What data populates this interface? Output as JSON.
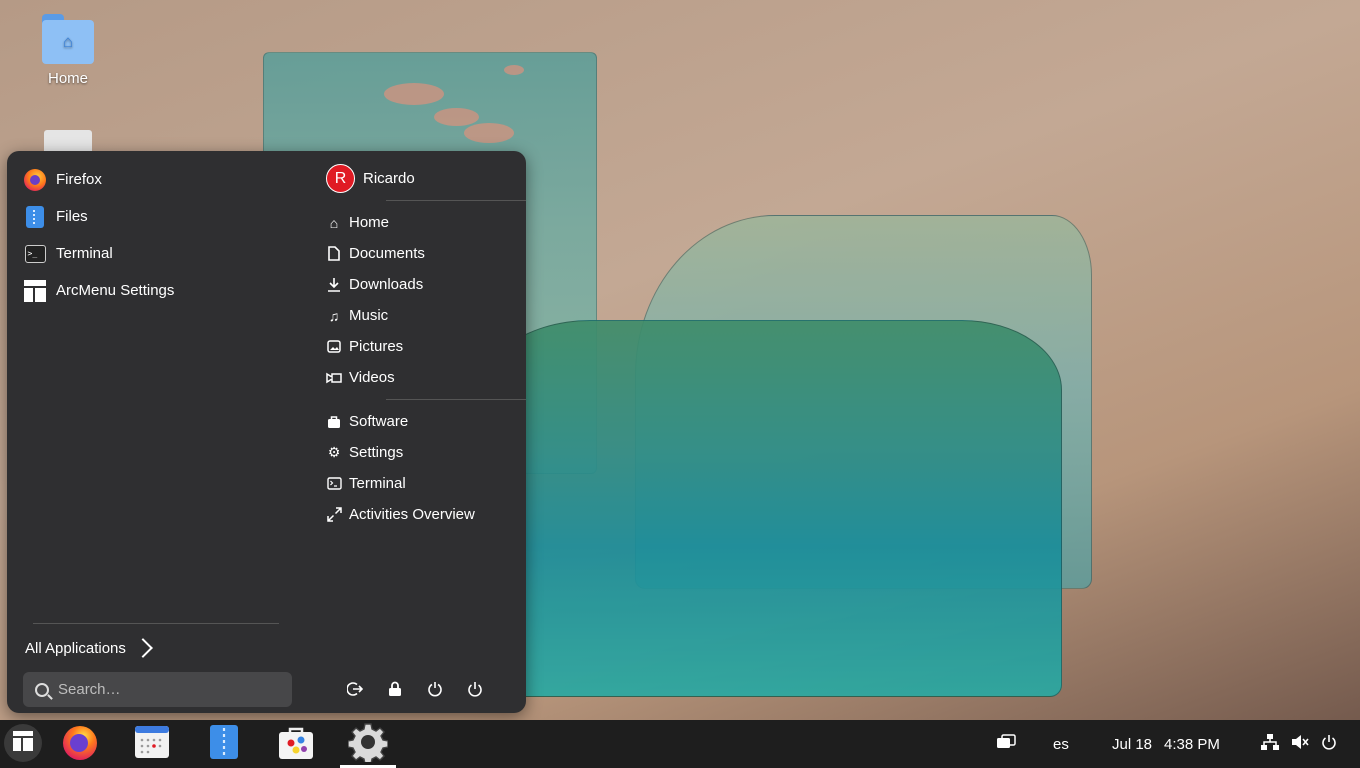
{
  "desktop": {
    "icons": [
      {
        "label": "Home"
      },
      {
        "label": ""
      }
    ]
  },
  "menu": {
    "apps": [
      {
        "label": "Firefox",
        "icon": "firefox-icon"
      },
      {
        "label": "Files",
        "icon": "files-icon"
      },
      {
        "label": "Terminal",
        "icon": "terminal-icon"
      },
      {
        "label": "ArcMenu Settings",
        "icon": "arcmenu-settings-icon"
      }
    ],
    "all_applications": "All Applications",
    "search_placeholder": "Search…",
    "user": {
      "initial": "R",
      "name": "Ricardo",
      "avatar_color": "#e01b24"
    },
    "places": [
      {
        "label": "Home",
        "icon": "home-icon"
      },
      {
        "label": "Documents",
        "icon": "document-icon"
      },
      {
        "label": "Downloads",
        "icon": "download-icon"
      },
      {
        "label": "Music",
        "icon": "music-icon"
      },
      {
        "label": "Pictures",
        "icon": "picture-icon"
      },
      {
        "label": "Videos",
        "icon": "video-icon"
      }
    ],
    "system": [
      {
        "label": "Software",
        "icon": "software-icon"
      },
      {
        "label": "Settings",
        "icon": "gear-icon"
      },
      {
        "label": "Terminal",
        "icon": "terminal-icon"
      },
      {
        "label": "Activities Overview",
        "icon": "expand-icon"
      }
    ],
    "actions": [
      "logout-icon",
      "lock-icon",
      "restart-icon",
      "power-icon"
    ]
  },
  "taskbar": {
    "apps": [
      "arcmenu-icon",
      "firefox-icon",
      "calendar-icon",
      "files-icon",
      "software-icon",
      "settings-icon"
    ],
    "active_app": "settings-icon",
    "keyboard_layout": "es",
    "date": "Jul 18",
    "time": "4:38 PM",
    "tray_icons": [
      "window-switcher-icon",
      "network-icon",
      "volume-muted-icon",
      "power-icon"
    ]
  }
}
